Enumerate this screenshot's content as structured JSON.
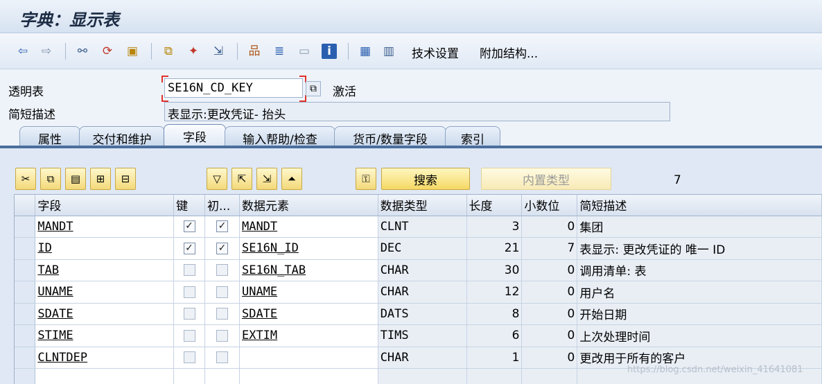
{
  "window": {
    "title": "字典：显示表"
  },
  "toolbar": {
    "icons": [
      "back-arrow-icon",
      "forward-arrow-icon",
      "glasses-icon",
      "display-change-icon",
      "object-icon",
      "where-used-icon",
      "wand-icon",
      "transport-icon",
      "hierarchy-icon",
      "stack-icon",
      "layout-icon",
      "info-icon",
      "structure-icon",
      "table-grid-icon"
    ],
    "tech_settings": "技术设置",
    "append_structure": "附加结构..."
  },
  "form": {
    "table_label": "透明表",
    "table_name": "SE16N_CD_KEY",
    "status": "激活",
    "desc_label": "简短描述",
    "desc_value": "表显示:更改凭证- 抬头"
  },
  "tabs": [
    "属性",
    "交付和维护",
    "字段",
    "输入帮助/检查",
    "货币/数量字段",
    "索引"
  ],
  "active_tab": "字段",
  "grid_toolbar": {
    "search": "搜索",
    "builtin_type": "内置类型",
    "count": "7"
  },
  "columns": [
    "字段",
    "键",
    "初...",
    "数据元素",
    "数据类型",
    "长度",
    "小数位",
    "简短描述"
  ],
  "rows": [
    {
      "field": "MANDT",
      "key": true,
      "init": true,
      "element": "MANDT",
      "type": "CLNT",
      "length": "3",
      "decimals": "0",
      "desc": "集团"
    },
    {
      "field": "ID",
      "key": true,
      "init": true,
      "element": "SE16N_ID",
      "type": "DEC",
      "length": "21",
      "decimals": "7",
      "desc": "表显示: 更改凭证的 唯一 ID"
    },
    {
      "field": "TAB",
      "key": false,
      "init": false,
      "element": "SE16N_TAB",
      "type": "CHAR",
      "length": "30",
      "decimals": "0",
      "desc": "调用清单: 表"
    },
    {
      "field": "UNAME",
      "key": false,
      "init": false,
      "element": "UNAME",
      "type": "CHAR",
      "length": "12",
      "decimals": "0",
      "desc": "用户名"
    },
    {
      "field": "SDATE",
      "key": false,
      "init": false,
      "element": "SDATE",
      "type": "DATS",
      "length": "8",
      "decimals": "0",
      "desc": "开始日期"
    },
    {
      "field": "STIME",
      "key": false,
      "init": false,
      "element": "EXTIM",
      "type": "TIMS",
      "length": "6",
      "decimals": "0",
      "desc": "上次处理时间"
    },
    {
      "field": "CLNTDEP",
      "key": false,
      "init": false,
      "element": "",
      "type": "CHAR",
      "length": "1",
      "decimals": "0",
      "desc": "更改用于所有的客户"
    }
  ],
  "watermark": "https://blog.csdn.net/weixin_41641081"
}
